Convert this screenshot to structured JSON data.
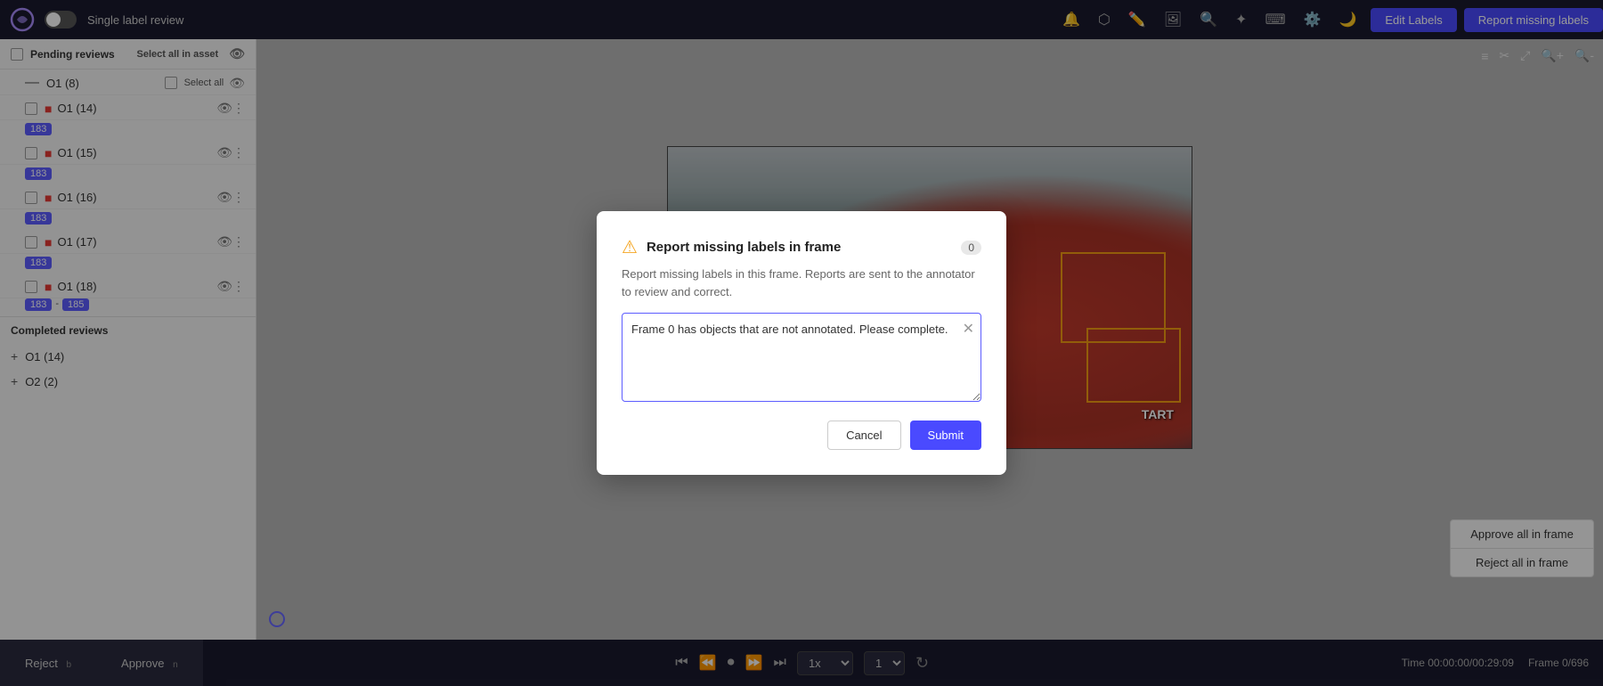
{
  "header": {
    "title": "Single label review",
    "edit_labels_btn": "Edit Labels",
    "report_missing_btn": "Report missing labels"
  },
  "sidebar": {
    "pending_section": "Pending reviews",
    "select_all_asset": "Select all in asset",
    "select_all": "Select all",
    "items": [
      {
        "id": "o1-8",
        "label": "O1 (8)",
        "type": "dash",
        "badges": []
      },
      {
        "id": "o1-14",
        "label": "O1 (14)",
        "type": "error",
        "badges": [
          "183"
        ]
      },
      {
        "id": "o1-15",
        "label": "O1 (15)",
        "type": "error",
        "badges": [
          "183"
        ]
      },
      {
        "id": "o1-16",
        "label": "O1 (16)",
        "type": "error",
        "badges": [
          "183"
        ]
      },
      {
        "id": "o1-17",
        "label": "O1 (17)",
        "type": "error",
        "badges": [
          "183"
        ]
      },
      {
        "id": "o1-18",
        "label": "O1 (18)",
        "type": "error",
        "badges": [
          "183",
          "185"
        ],
        "range": true
      }
    ],
    "completed_section": "Completed reviews",
    "completed_items": [
      {
        "id": "co1-14",
        "label": "O1 (14)"
      },
      {
        "id": "co2-2",
        "label": "O2 (2)"
      }
    ]
  },
  "modal": {
    "title": "Report missing labels in frame",
    "badge": "0",
    "desc": "Report missing labels in this frame. Reports are sent to the annotator to review and correct.",
    "textarea_value": "Frame 0 has objects that are not annotated. Please complete.",
    "cancel_btn": "Cancel",
    "submit_btn": "Submit"
  },
  "frame_actions": {
    "approve_btn": "Approve all in frame",
    "reject_btn": "Reject all in frame"
  },
  "bottom_bar": {
    "reject_btn": "Reject",
    "reject_key": "b",
    "approve_btn": "Approve",
    "approve_key": "n",
    "speed": "1x",
    "frame_num": "1",
    "time": "Time  00:00:00/00:29:09",
    "frame": "Frame  0/696"
  }
}
